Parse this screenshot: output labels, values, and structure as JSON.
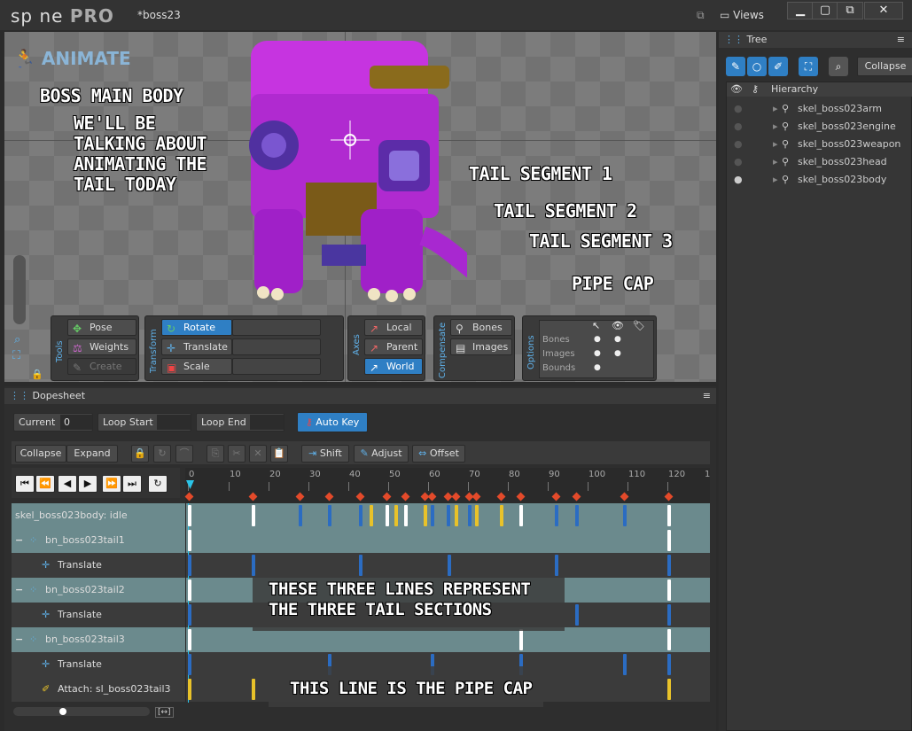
{
  "app": {
    "logo_text": "sp ne",
    "logo_pro": "PRO",
    "doc_title": "*boss23"
  },
  "window": {
    "views_label": "Views",
    "min": "▁",
    "max": "▢",
    "restore": "⧉",
    "close": "✕"
  },
  "viewport": {
    "mode_label": "ANIMATE",
    "annotations": {
      "main_body": "BOSS MAIN BODY",
      "tail_note_1": "WE'LL BE",
      "tail_note_2": "TALKING ABOUT",
      "tail_note_3": "ANIMATING THE",
      "tail_note_4": "TAIL TODAY",
      "seg1": "TAIL SEGMENT 1",
      "seg2": "TAIL SEGMENT 2",
      "seg3": "TAIL SEGMENT 3",
      "pipe_cap": "PIPE CAP"
    },
    "tools": {
      "label": "Tools",
      "pose": "Pose",
      "weights": "Weights",
      "create": "Create"
    },
    "transform": {
      "label": "Transform",
      "rotate": "Rotate",
      "translate": "Translate",
      "scale": "Scale"
    },
    "axes": {
      "label": "Axes",
      "local": "Local",
      "parent": "Parent",
      "world": "World"
    },
    "compensate": {
      "label": "Compensate",
      "bones": "Bones",
      "images": "Images"
    },
    "options": {
      "label": "Options",
      "bones": "Bones",
      "images": "Images",
      "bounds": "Bounds"
    }
  },
  "tree": {
    "tab": "Tree",
    "collapse": "Collapse",
    "hierarchy": "Hierarchy",
    "items": [
      "skel_boss023arm",
      "skel_boss023engine",
      "skel_boss023weapon",
      "skel_boss023head",
      "skel_boss023body"
    ]
  },
  "dopesheet": {
    "title": "Dopesheet",
    "current_label": "Current",
    "current_value": "0",
    "loop_start": "Loop Start",
    "loop_end": "Loop End",
    "auto_key": "Auto Key",
    "collapse": "Collapse",
    "expand": "Expand",
    "shift": "Shift",
    "adjust": "Adjust",
    "offset": "Offset",
    "ruler": [
      "0",
      "10",
      "20",
      "30",
      "40",
      "50",
      "60",
      "70",
      "80",
      "90",
      "100",
      "110",
      "120",
      "1"
    ],
    "rows": [
      "skel_boss023body: idle",
      "bn_boss023tail1",
      "Translate",
      "bn_boss023tail2",
      "Translate",
      "bn_boss023tail3",
      "Translate",
      "Attach: sl_boss023tail3"
    ],
    "overlay_1a": "THESE THREE LINES REPRESENT",
    "overlay_1b": "THE THREE TAIL SECTIONS",
    "overlay_2": "THIS LINE IS THE PIPE CAP"
  },
  "colors": {
    "accent": "#2f7fc4",
    "key_white": "#ffffff",
    "key_blue": "#2b6cc2",
    "key_yellow": "#e8c22a",
    "diamond": "#e34a2a",
    "row_teal": "#6b8a8d"
  }
}
